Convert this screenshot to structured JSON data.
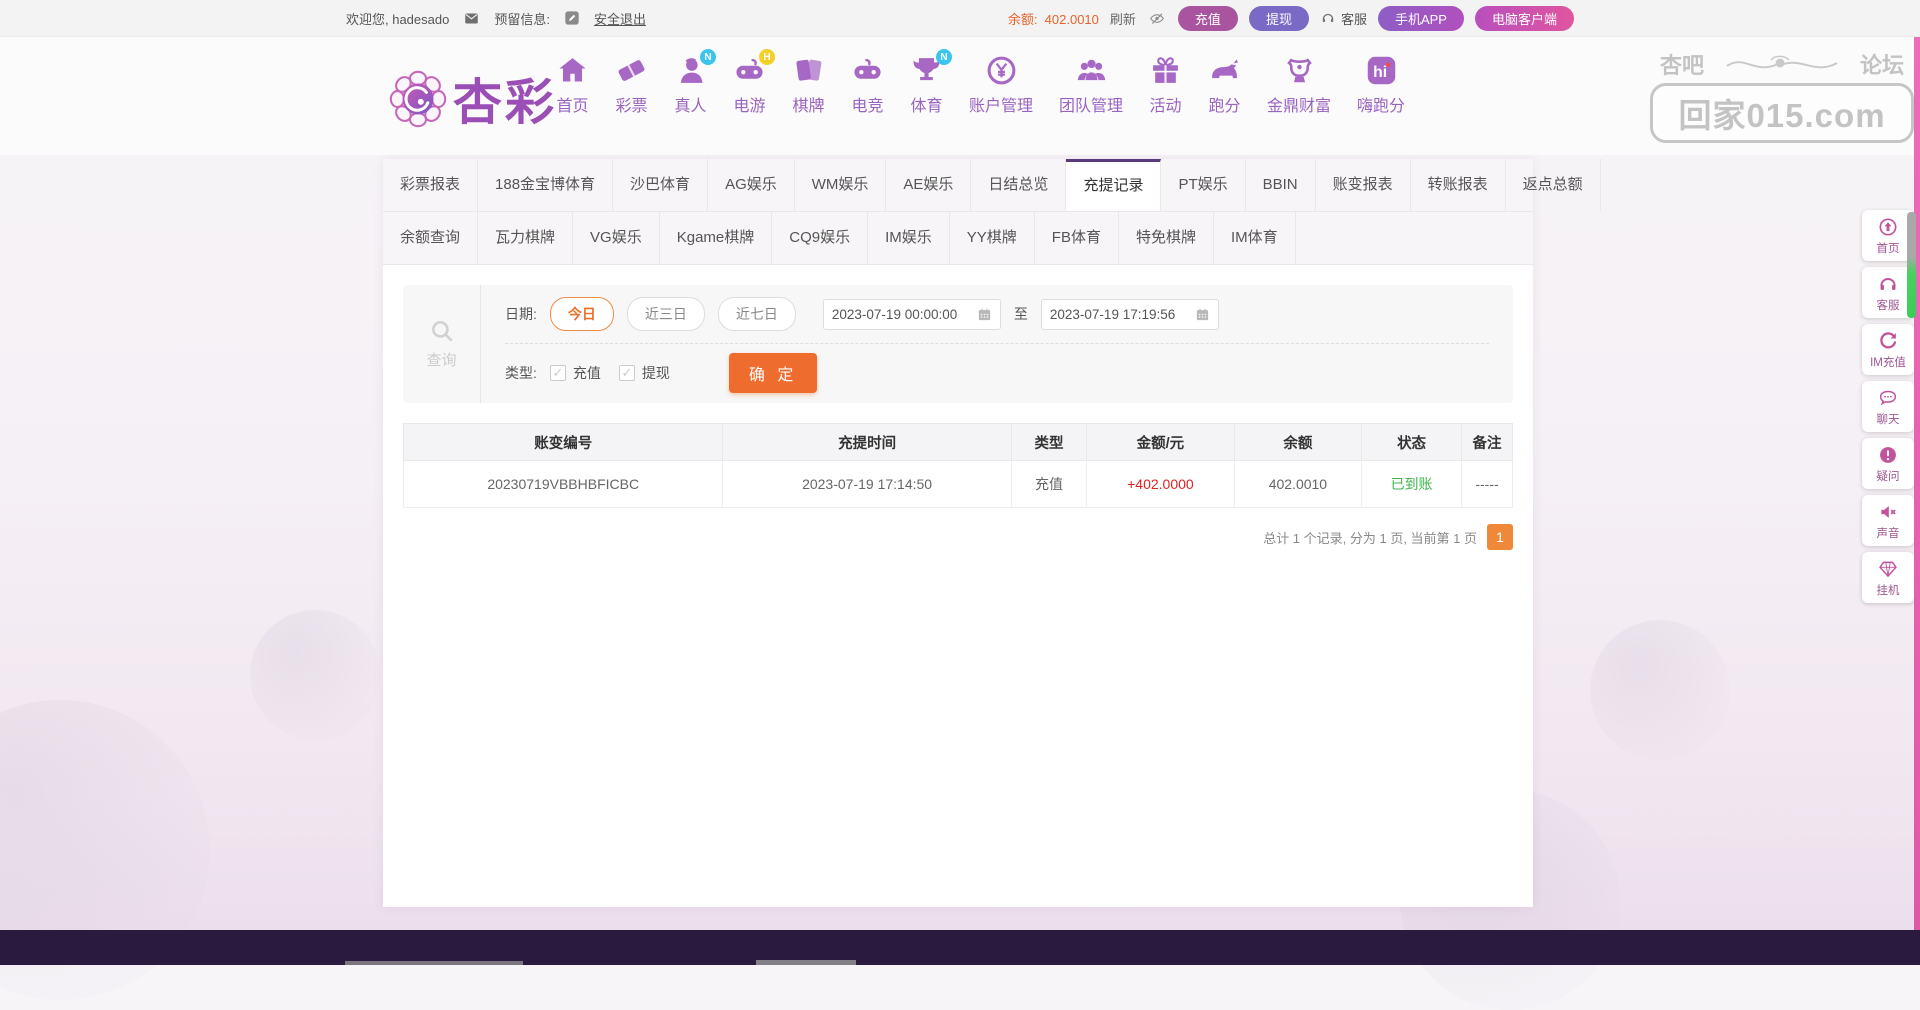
{
  "topbar": {
    "welcome": "欢迎您, hadesado",
    "message_icon": "envelope-icon",
    "reserved_info_label": "预留信息:",
    "edit_icon": "pencil-icon",
    "logout": "安全退出",
    "balance_label": "余额:",
    "balance_value": "402.0010",
    "refresh": "刷新",
    "eye_icon": "eye-off-icon",
    "recharge_btn": "充值",
    "withdraw_btn": "提现",
    "service": "客服",
    "mobile_app_btn": "手机APP",
    "pc_client_btn": "电脑客户端"
  },
  "header": {
    "logo_text": "杏彩",
    "nav": [
      {
        "label": "首页",
        "icon": "home-icon"
      },
      {
        "label": "彩票",
        "icon": "ticket-icon"
      },
      {
        "label": "真人",
        "icon": "live-person-icon",
        "badge": "N",
        "badge_color": "#38c5ef"
      },
      {
        "label": "电游",
        "icon": "gamepad-icon",
        "badge": "H",
        "badge_color": "#f2d026"
      },
      {
        "label": "棋牌",
        "icon": "cards-icon"
      },
      {
        "label": "电竞",
        "icon": "esports-icon"
      },
      {
        "label": "体育",
        "icon": "trophy-icon",
        "badge": "N",
        "badge_color": "#38c5ef"
      },
      {
        "label": "账户管理",
        "icon": "coin-icon"
      },
      {
        "label": "团队管理",
        "icon": "team-icon"
      },
      {
        "label": "活动",
        "icon": "gift-icon"
      },
      {
        "label": "跑分",
        "icon": "rhino-icon"
      },
      {
        "label": "金鼎财富",
        "icon": "treasure-icon"
      },
      {
        "label": "嗨跑分",
        "icon": "hi-app-icon"
      }
    ],
    "watermark": {
      "top_left": "杏吧",
      "top_right": "论坛",
      "domain": "回家015.com"
    }
  },
  "tabs": {
    "row1": [
      "彩票报表",
      "188金宝博体育",
      "沙巴体育",
      "AG娱乐",
      "WM娱乐",
      "AE娱乐",
      "日结总览",
      "充提记录",
      "PT娱乐",
      "BBIN",
      "账变报表",
      "转账报表",
      "返点总额"
    ],
    "active": "充提记录",
    "row2": [
      "余额查询",
      "瓦力棋牌",
      "VG娱乐",
      "Kgame棋牌",
      "CQ9娱乐",
      "IM娱乐",
      "YY棋牌",
      "FB体育",
      "特免棋牌",
      "IM体育"
    ]
  },
  "filter": {
    "search_icon": "search-icon",
    "search_label": "查询",
    "date_label": "日期:",
    "date_presets": [
      "今日",
      "近三日",
      "近七日"
    ],
    "active_preset": "今日",
    "date_from": "2023-07-19 00:00:00",
    "to_label": "至",
    "date_to": "2023-07-19 17:19:56",
    "type_label": "类型:",
    "type_options": [
      "充值",
      "提现"
    ],
    "submit": "确 定"
  },
  "table": {
    "headers": [
      "账变编号",
      "充提时间",
      "类型",
      "金额/元",
      "余额",
      "状态",
      "备注"
    ],
    "col_names": [
      "change-id",
      "time",
      "type",
      "amount",
      "balance",
      "status",
      "remark"
    ],
    "rows": [
      [
        "20230719VBBHBFICBC",
        "2023-07-19 17:14:50",
        "充值",
        "+402.0000",
        "402.0010",
        "已到账",
        "-----"
      ]
    ]
  },
  "pagination": {
    "summary": "总计 1 个记录, 分为 1 页, 当前第 1 页",
    "current_page": "1"
  },
  "sidebar": [
    {
      "label": "首页",
      "icon": "back-top-icon"
    },
    {
      "label": "客服",
      "icon": "headset-icon"
    },
    {
      "label": "IM充值",
      "icon": "im-recharge-icon"
    },
    {
      "label": "聊天",
      "icon": "chat-icon"
    },
    {
      "label": "疑问",
      "icon": "exclaim-icon"
    },
    {
      "label": "声音",
      "icon": "mute-icon"
    },
    {
      "label": "挂机",
      "icon": "diamond-icon"
    }
  ],
  "colors": {
    "recharge_purple": "#a8549e",
    "withdraw_purple": "#7a6ac6",
    "balance_orange": "#e8622c",
    "submit_orange": "#ed6c2e",
    "amount_red": "#e02222",
    "status_green": "#3cb54a",
    "active_tab_border": "#5a3a7e",
    "page_btn_orange": "#f0883a",
    "sidebar_pink": "#c0559c",
    "nav_purple": "#9a63bf"
  }
}
